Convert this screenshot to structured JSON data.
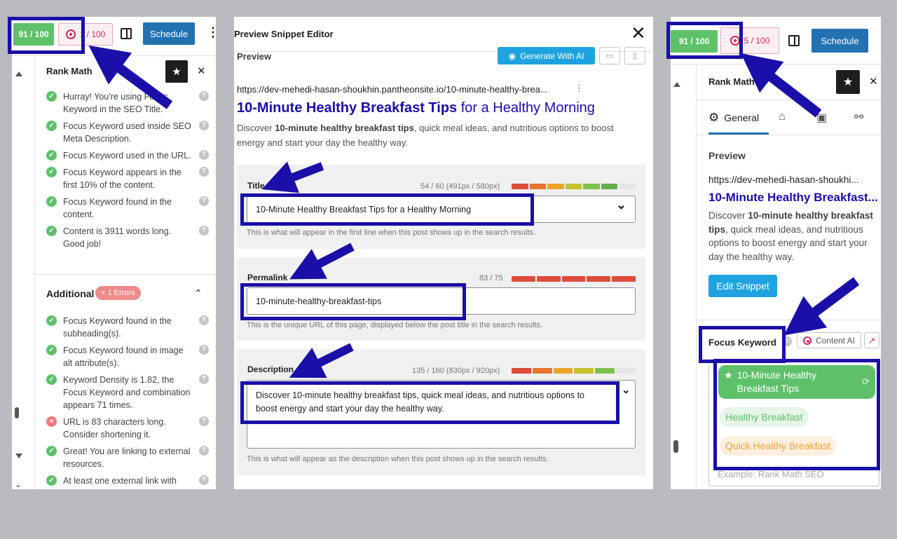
{
  "left": {
    "seo_score": "91 / 100",
    "ai_score": "1 / 100",
    "schedule_label": "Schedule",
    "more_glyph": "⋮",
    "panel_title": "Rank Math",
    "close_glyph": "✕",
    "checks": [
      {
        "text": "Hurray! You're using Focus Keyword in the SEO Title.",
        "status": "ok"
      },
      {
        "text": "Focus Keyword used inside SEO Meta Description.",
        "status": "ok"
      },
      {
        "text": "Focus Keyword used in the URL.",
        "status": "ok"
      },
      {
        "text": "Focus Keyword appears in the first 10% of the content.",
        "status": "ok"
      },
      {
        "text": "Focus Keyword found in the content.",
        "status": "ok"
      },
      {
        "text": "Content is 3911 words long. Good job!",
        "status": "ok"
      }
    ],
    "additional_title": "Additional",
    "errors_badge": "× 1 Errors",
    "additional_checks": [
      {
        "text": "Focus Keyword found in the subheading(s).",
        "status": "ok"
      },
      {
        "text": "Focus Keyword found in image alt attribute(s).",
        "status": "ok"
      },
      {
        "text": "Keyword Density is 1.82, the Focus Keyword and combination appears 71 times.",
        "status": "ok"
      },
      {
        "text": "URL is 83 characters long. Consider shortening it.",
        "status": "bad"
      },
      {
        "text": "Great! You are linking to external resources.",
        "status": "ok"
      },
      {
        "text": "At least one external link with",
        "status": "ok"
      }
    ]
  },
  "middle": {
    "title": "Preview Snippet Editor",
    "close_glyph": "✕",
    "preview_label": "Preview",
    "generate_ai_label": "Generate With AI",
    "url": "https://dev-mehedi-hasan-shoukhin.pantheonsite.io/10-minute-healthy-brea...",
    "headline_bold": "10-Minute Healthy Breakfast Tips",
    "headline_rest": " for a Healthy Morning",
    "desc_prefix": "Discover ",
    "desc_bold": "10-minute healthy breakfast tips",
    "desc_rest": ", quick meal ideas, and nutritious options to boost energy and start your day the healthy way.",
    "fields": {
      "title_label": "Title",
      "title_count": "54 / 60 (491px / 580px)",
      "title_value": "10-Minute Healthy Breakfast Tips for a Healthy Morning",
      "title_help": "This is what will appear in the first line when this post shows up in the search results.",
      "permalink_label": "Permalink",
      "permalink_count": "83 / 75",
      "permalink_value": "10-minute-healthy-breakfast-tips",
      "permalink_help": "This is the unique URL of this page, displayed below the post title in the search results.",
      "description_label": "Description",
      "description_count": "135 / 160 (830px / 920px)",
      "description_value": "Discover 10-minute healthy breakfast tips, quick meal ideas, and nutritious options to boost energy and start your day the healthy way.",
      "description_help": "This is what will appear as the description when this post shows up in the search results."
    }
  },
  "right": {
    "seo_score": "91 / 100",
    "ai_score": "5 / 100",
    "schedule_label": "Schedule",
    "panel_title": "Rank Math",
    "close_glyph": "✕",
    "tab_general": "General",
    "preview_label": "Preview",
    "url": "https://dev-mehedi-hasan-shoukhi...",
    "headline": "10-Minute Healthy Breakfast...",
    "desc_prefix": "Discover ",
    "desc_bold": "10-minute healthy breakfast tips",
    "desc_rest": ", quick meal ideas, and nutritious options to boost energy and start your day the healthy way.",
    "edit_snippet_label": "Edit Snippet",
    "focus_keyword_label": "Focus Keyword",
    "content_ai_label": "Content AI",
    "keywords": [
      "10-Minute Healthy Breakfast Tips",
      "Healthy Breakfast",
      "Quick Healthy Breakfast"
    ],
    "placeholder": "Example: Rank Math SEO"
  },
  "colors": {
    "accent_blue": "#1a0fa8",
    "score_green": "#5ec16a",
    "wp_blue": "#2271b1",
    "ai_pink": "#d7285a",
    "rank_teal": "#1fa3e0"
  }
}
